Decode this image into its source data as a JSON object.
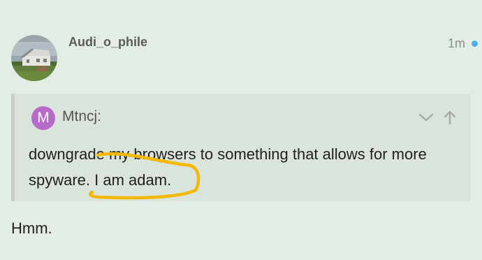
{
  "post": {
    "username": "Audi_o_phile",
    "timestamp": "1m",
    "avatar_icon": "house-photo-avatar",
    "unread_color": "#4aaee8"
  },
  "quote": {
    "avatar_letter": "M",
    "avatar_color": "#b86acb",
    "author": "Mtncj:",
    "text": "downgrade my browsers to something that allows for more spyware. I am adam.",
    "controls": [
      "chevron-down-icon",
      "arrow-up-icon"
    ]
  },
  "annotation": {
    "color": "#f5b800",
    "shape": "hand-drawn-underline"
  },
  "reply": {
    "text": "Hmm."
  }
}
